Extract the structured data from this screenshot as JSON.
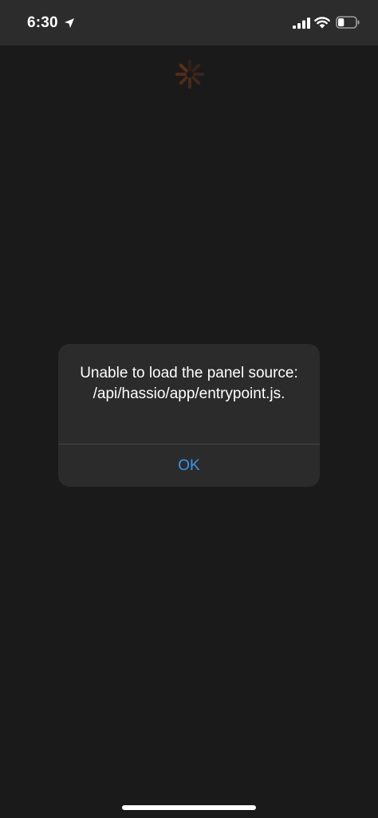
{
  "status_bar": {
    "time": "6:30",
    "icons": [
      "location-arrow-icon",
      "cellular-signal-icon",
      "wifi-icon",
      "battery-icon"
    ],
    "battery_level": 0.35
  },
  "loading": {
    "icon": "spinner-icon",
    "color": "#5a2f1c"
  },
  "alert": {
    "message": "Unable to load the panel source: /api/hassio/app/entrypoint.js.",
    "ok_label": "OK",
    "accent_color": "#3d95e8"
  }
}
